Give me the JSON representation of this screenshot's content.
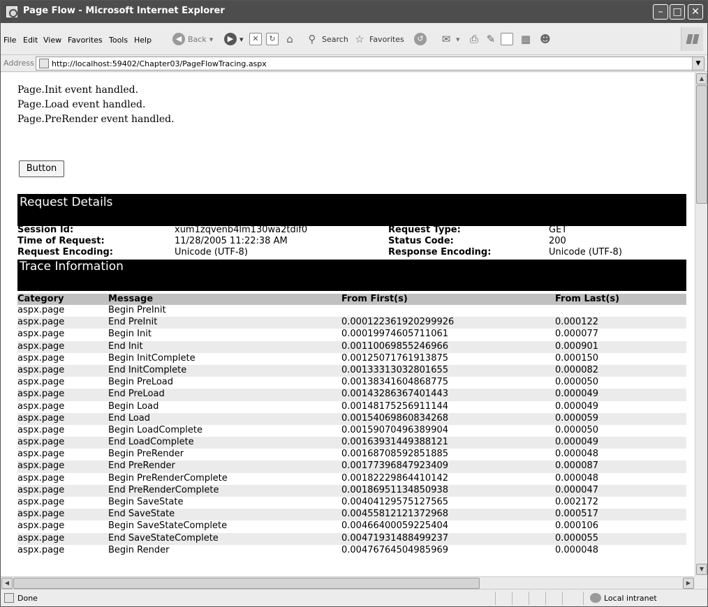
{
  "window": {
    "title": "Page Flow - Microsoft Internet Explorer"
  },
  "menubar": {
    "file": "File",
    "edit": "Edit",
    "view": "View",
    "favorites": "Favorites",
    "tools": "Tools",
    "help": "Help",
    "back": "Back",
    "search": "Search",
    "favorites_btn": "Favorites"
  },
  "address": {
    "label": "Address",
    "url": "http://localhost:59402/Chapter03/PageFlowTracing.aspx"
  },
  "page": {
    "events": [
      "Page.Init event handled.",
      "Page.Load event handled.",
      "Page.PreRender event handled."
    ],
    "button_label": "Button"
  },
  "request_details": {
    "heading": "Request Details",
    "session_id_label": "Session Id:",
    "session_id": "xum1zqvenb4lm130wa2tdif0",
    "request_type_label": "Request Type:",
    "request_type": "GET",
    "time_label": "Time of Request:",
    "time": "11/28/2005 11:22:38 AM",
    "status_code_label": "Status Code:",
    "status_code": "200",
    "req_enc_label": "Request Encoding:",
    "req_enc": "Unicode (UTF-8)",
    "resp_enc_label": "Response Encoding:",
    "resp_enc": "Unicode (UTF-8)"
  },
  "trace": {
    "heading": "Trace Information",
    "columns": [
      "Category",
      "Message",
      "From First(s)",
      "From Last(s)"
    ],
    "rows": [
      [
        "aspx.page",
        "Begin PreInit",
        "",
        ""
      ],
      [
        "aspx.page",
        "End PreInit",
        "0.000122361920299926",
        "0.000122"
      ],
      [
        "aspx.page",
        "Begin Init",
        "0.00019974605711061",
        "0.000077"
      ],
      [
        "aspx.page",
        "End Init",
        "0.00110069855246966",
        "0.000901"
      ],
      [
        "aspx.page",
        "Begin InitComplete",
        "0.00125071761913875",
        "0.000150"
      ],
      [
        "aspx.page",
        "End InitComplete",
        "0.00133313032801655",
        "0.000082"
      ],
      [
        "aspx.page",
        "Begin PreLoad",
        "0.00138341604868775",
        "0.000050"
      ],
      [
        "aspx.page",
        "End PreLoad",
        "0.00143286367401443",
        "0.000049"
      ],
      [
        "aspx.page",
        "Begin Load",
        "0.00148175256911144",
        "0.000049"
      ],
      [
        "aspx.page",
        "End Load",
        "0.00154069860834268",
        "0.000059"
      ],
      [
        "aspx.page",
        "Begin LoadComplete",
        "0.00159070496389904",
        "0.000050"
      ],
      [
        "aspx.page",
        "End LoadComplete",
        "0.00163931449388121",
        "0.000049"
      ],
      [
        "aspx.page",
        "Begin PreRender",
        "0.00168708592851885",
        "0.000048"
      ],
      [
        "aspx.page",
        "End PreRender",
        "0.00177396847923409",
        "0.000087"
      ],
      [
        "aspx.page",
        "Begin PreRenderComplete",
        "0.00182229864410142",
        "0.000048"
      ],
      [
        "aspx.page",
        "End PreRenderComplete",
        "0.00186951134850938",
        "0.000047"
      ],
      [
        "aspx.page",
        "Begin SaveState",
        "0.00404129575127565",
        "0.002172"
      ],
      [
        "aspx.page",
        "End SaveState",
        "0.00455812121372968",
        "0.000517"
      ],
      [
        "aspx.page",
        "Begin SaveStateComplete",
        "0.00466400059225404",
        "0.000106"
      ],
      [
        "aspx.page",
        "End SaveStateComplete",
        "0.00471931488499237",
        "0.000055"
      ],
      [
        "aspx.page",
        "Begin Render",
        "0.00476764504985969",
        "0.000048"
      ]
    ]
  },
  "status": {
    "text": "Done",
    "zone": "Local intranet"
  }
}
